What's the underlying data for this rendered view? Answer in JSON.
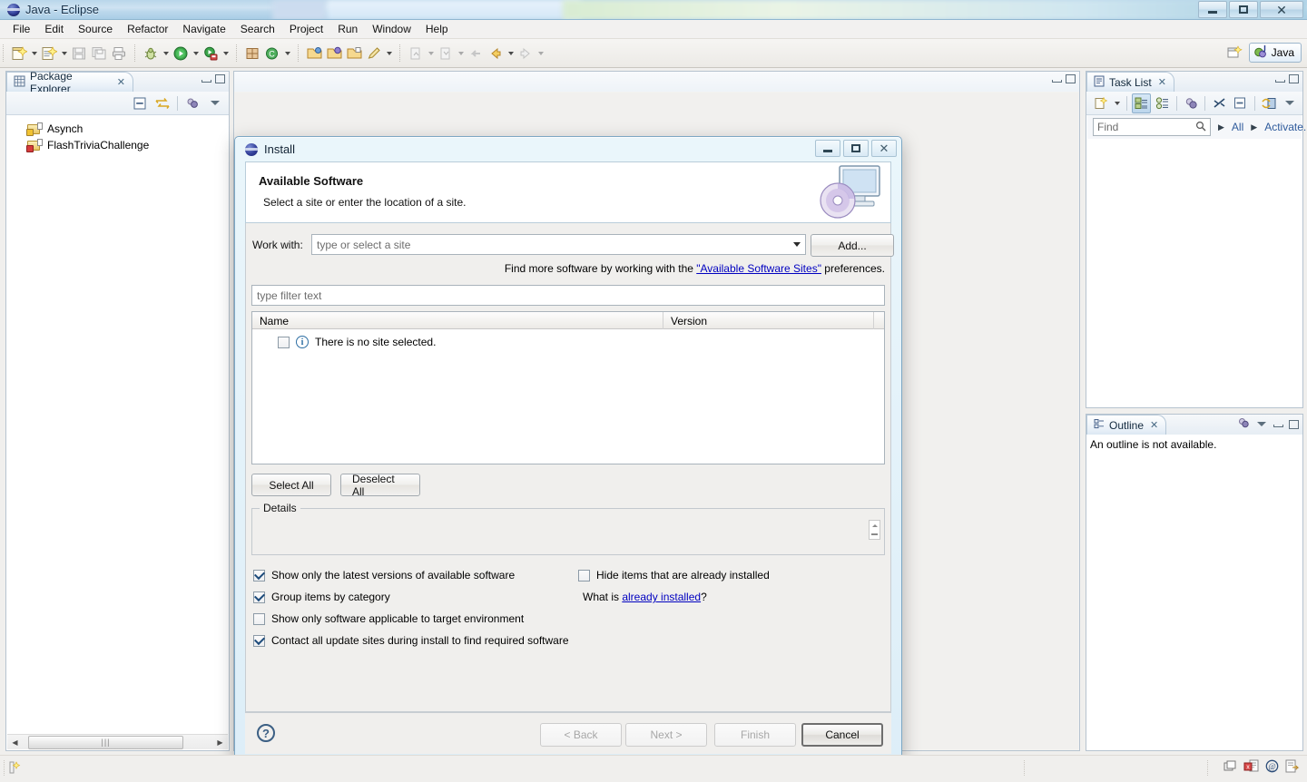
{
  "window": {
    "title": "Java - Eclipse",
    "app_icon": "eclipse-icon",
    "controls": {
      "minimize": "–",
      "maximize": "❐",
      "close": "✕"
    }
  },
  "menubar": {
    "items": [
      "File",
      "Edit",
      "Source",
      "Refactor",
      "Navigate",
      "Search",
      "Project",
      "Run",
      "Window",
      "Help"
    ]
  },
  "toolbar": {
    "groups": [
      {
        "buttons": [
          {
            "icon": "new-wizard-icon",
            "dropdown": true
          },
          {
            "icon": "new-java-project-icon",
            "dropdown": true
          },
          {
            "icon": "save-icon",
            "dropdown": false
          },
          {
            "icon": "save-all-icon",
            "dropdown": false
          },
          {
            "icon": "print-icon",
            "dropdown": false
          }
        ]
      },
      {
        "buttons": [
          {
            "icon": "debug-icon",
            "dropdown": true
          },
          {
            "icon": "run-icon",
            "dropdown": true
          },
          {
            "icon": "run-external-tools-icon",
            "dropdown": true
          }
        ]
      },
      {
        "buttons": [
          {
            "icon": "new-java-package-icon",
            "dropdown": false
          },
          {
            "icon": "new-class-icon",
            "dropdown": true
          }
        ]
      },
      {
        "buttons": [
          {
            "icon": "open-type-icon",
            "dropdown": false
          },
          {
            "icon": "open-task-icon",
            "dropdown": false
          },
          {
            "icon": "open-resource-icon",
            "dropdown": false
          },
          {
            "icon": "toggle-mark-occurrences-icon",
            "dropdown": true
          }
        ]
      },
      {
        "buttons": [
          {
            "icon": "previous-annotation-icon",
            "dropdown": true
          },
          {
            "icon": "next-annotation-icon",
            "dropdown": true
          },
          {
            "icon": "last-edit-location-icon",
            "dropdown": false
          },
          {
            "icon": "back-icon",
            "dropdown": true
          },
          {
            "icon": "forward-icon",
            "dropdown": true
          }
        ]
      }
    ],
    "perspective": {
      "open_perspective": "open-perspective-icon",
      "active_label": "Java",
      "active_icon": "java-perspective-icon"
    }
  },
  "package_explorer": {
    "tab_label": "Package Explorer",
    "close_glyph": "✕",
    "toolbar": [
      {
        "icon": "collapse-all-icon"
      },
      {
        "icon": "link-with-editor-icon"
      },
      {
        "icon": "view-menu-focus-icon"
      },
      {
        "icon": "view-menu-icon"
      }
    ],
    "items": [
      {
        "label": "Asynch",
        "icon": "java-project-icon"
      },
      {
        "label": "FlashTriviaChallenge",
        "icon": "java-project-error-icon"
      }
    ],
    "hscroll_thumb_glyph": "|||"
  },
  "editor_area": {
    "minimize_glyph": "–",
    "maximize_glyph": "❐"
  },
  "task_list": {
    "tab_label": "Task List",
    "close_glyph": "✕",
    "toolbar": [
      {
        "icon": "new-task-icon",
        "dropdown": true
      },
      {
        "icon": "categorized-presentation-icon",
        "pressed": true
      },
      {
        "icon": "scheduled-presentation-icon"
      },
      {
        "icon": "focus-on-workweek-icon"
      },
      {
        "icon": "collapse-all-icon"
      },
      {
        "icon": "minimize-icon"
      },
      {
        "icon": "synchronize-changed-icon"
      },
      {
        "icon": "view-menu-icon"
      }
    ],
    "find_placeholder": "Find",
    "find_icon": "search-icon",
    "filters": [
      "All",
      "Activate..."
    ]
  },
  "outline": {
    "tab_label": "Outline",
    "close_glyph": "✕",
    "empty_message": "An outline is not available.",
    "toolbar": [
      {
        "icon": "focus-icon"
      },
      {
        "icon": "view-menu-icon"
      }
    ]
  },
  "statusbar": {
    "left_icon": "writable-indicator-icon",
    "right_icons": [
      "tile-editors-icon",
      "build-error-icon",
      "email-icon",
      "open-perspective-shortcut-icon"
    ]
  },
  "dialog": {
    "title": "Install",
    "icon": "eclipse-icon",
    "controls": {
      "minimize": "–",
      "maximize": "❐",
      "close": "✕"
    },
    "banner": {
      "heading": "Available Software",
      "subheading": "Select a site or enter the location of a site.",
      "art": "install-cd-monitor-icon"
    },
    "work_with": {
      "label": "Work with:",
      "placeholder": "type or select a site",
      "value": "",
      "add_button": "Add..."
    },
    "hint": {
      "prefix": "Find more software by working with the ",
      "link": "\"Available Software Sites\"",
      "suffix": " preferences."
    },
    "filter": {
      "placeholder": "type filter text",
      "value": ""
    },
    "table": {
      "columns": [
        "Name",
        "Version"
      ],
      "rows": [
        {
          "checked": false,
          "icon": "info-icon",
          "name": "There is no site selected.",
          "version": ""
        }
      ]
    },
    "select_all_button": "Select All",
    "deselect_all_button": "Deselect All",
    "details": {
      "label": "Details",
      "value": "",
      "spinner": "details-spinner"
    },
    "options_left": [
      {
        "label": "Show only the latest versions of available software",
        "checked": true
      },
      {
        "label": "Group items by category",
        "checked": true
      },
      {
        "label": "Show only software applicable to target environment",
        "checked": false
      },
      {
        "label": "Contact all update sites during install to find required software",
        "checked": true
      }
    ],
    "options_right": [
      {
        "label": "Hide items that are already installed",
        "checked": false
      }
    ],
    "already_installed": {
      "prefix": "What is ",
      "link": "already installed",
      "suffix": "?"
    },
    "footer": {
      "help_icon": "help-icon",
      "buttons": [
        {
          "label": "< Back",
          "disabled": true,
          "default": false
        },
        {
          "label": "Next >",
          "disabled": true,
          "default": false
        },
        {
          "label": "Finish",
          "disabled": true,
          "default": false
        },
        {
          "label": "Cancel",
          "disabled": false,
          "default": true
        }
      ]
    }
  },
  "colors": {
    "link": "#0000c0",
    "titlebar": "#bcd8ec",
    "dialog_bg": "#ddeef8",
    "panel_bg": "#f0efed"
  }
}
